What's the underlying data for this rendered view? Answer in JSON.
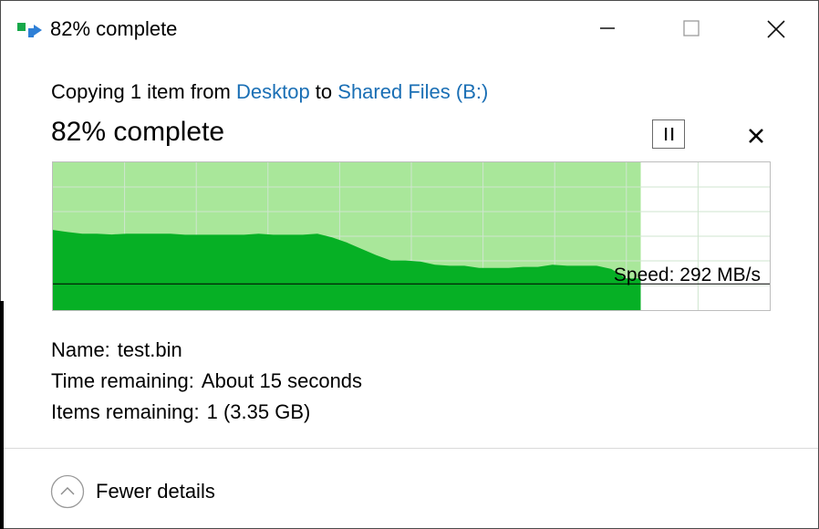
{
  "window": {
    "title": "82% complete",
    "icon": "copy-transfer-icon"
  },
  "copy": {
    "prefix": "Copying 1 item from ",
    "source": "Desktop",
    "middle": " to ",
    "destination": "Shared Files (B:)"
  },
  "progress": {
    "heading": "82% complete",
    "fraction": 0.82
  },
  "graph": {
    "speed_label": "Speed: 292 MB/s",
    "speed_history_mbps": [
      380,
      370,
      362,
      362,
      358,
      362,
      362,
      362,
      362,
      357,
      357,
      357,
      357,
      357,
      362,
      357,
      357,
      357,
      362,
      345,
      320,
      290,
      260,
      235,
      235,
      230,
      215,
      210,
      210,
      200,
      200,
      200,
      205,
      205,
      215,
      210,
      210,
      210,
      195,
      150,
      150
    ],
    "current_speed_mbps": 292,
    "colors": {
      "done_fill": "#a9e79a",
      "speed_fill": "#06b025",
      "grid": "#cfe6cf",
      "speed_line": "#000000"
    }
  },
  "details": {
    "name_label": "Name:",
    "name_value": "test.bin",
    "time_label": "Time remaining:",
    "time_value": "About 15 seconds",
    "items_label": "Items remaining:",
    "items_value": "1 (3.35 GB)"
  },
  "footer": {
    "toggle_label": "Fewer details"
  }
}
